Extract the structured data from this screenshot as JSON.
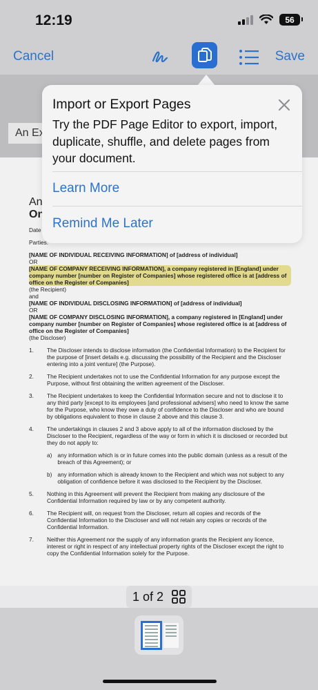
{
  "status_bar": {
    "time": "12:19",
    "battery": "56"
  },
  "toolbar": {
    "cancel_label": "Cancel",
    "save_label": "Save"
  },
  "document_title": "An Ex",
  "popover": {
    "title": "Import or Export Pages",
    "description": "Try the PDF Page Editor to export, import, duplicate, shuffle, and delete pages from your document.",
    "learn_more": "Learn More",
    "remind_later": "Remind Me Later"
  },
  "document": {
    "heading_line1": "An",
    "heading_line2": "On",
    "date_label": "Date",
    "parties_label": "Parties:",
    "parties": [
      "[NAME OF INDIVIDUAL RECEIVING INFORMATION] of [address of individual]",
      "OR",
      "[NAME OF COMPANY RECEIVING INFORMATION], a company registered in [England] under company number [number on Register of Companies] whose registered office is at [address of office on the Register of Companies]",
      "(the Recipient)",
      "and",
      "[NAME OF INDIVIDUAL DISCLOSING INFORMATION] of [address of individual]",
      "OR",
      "[NAME OF COMPANY DISCLOSING INFORMATION], a company registered in [England] under company number [number on Register of Companies] whose registered office is at [address of office on the Register of Companies]",
      "(the Discloser)"
    ],
    "clauses": [
      {
        "n": "1.",
        "text": "The Discloser intends to disclose information (the Confidential Information) to the Recipient for the purpose of [insert details e.g. discussing the possibility of the Recipient and the Discloser entering into a joint venture] (the Purpose)."
      },
      {
        "n": "2.",
        "text": "The Recipient undertakes not to use the Confidential Information for any purpose except the Purpose, without first obtaining the written agreement of the Discloser."
      },
      {
        "n": "3.",
        "text": "The Recipient undertakes to keep the Confidential Information secure and not to disclose it to any third party [except to its employees [and professional advisers] who need to know the same for the Purpose, who know they owe a duty of confidence to the Discloser and who are bound by obligations equivalent to those in clause 2 above and this clause 3."
      },
      {
        "n": "4.",
        "text": "The undertakings in clauses 2 and 3 above apply to all of the information disclosed by the Discloser to the Recipient, regardless of the way or form in which it is disclosed or recorded but they do not apply to:"
      }
    ],
    "subclauses": [
      {
        "n": "a)",
        "text": "any information which is or in future comes into the public domain (unless as a result of the breach of this Agreement); or"
      },
      {
        "n": "b)",
        "text": "any information which is already known to the Recipient and which was not subject to any obligation of confidence before it was disclosed to the Recipient by the Discloser."
      }
    ],
    "clauses_2": [
      {
        "n": "5.",
        "text": "Nothing in this Agreement will prevent the Recipient from making any disclosure of the Confidential Information required by law or by any competent authority."
      },
      {
        "n": "6.",
        "text": "The Recipient will, on request from the Discloser, return all copies and records of the Confidential Information to the Discloser and will not retain any copies or records of the Confidential Information."
      },
      {
        "n": "7.",
        "text": "Neither this Agreement nor the supply of any information grants the Recipient any licence, interest or right in respect of any intellectual property rights of the Discloser except the right to copy the Confidential Information solely for the Purpose."
      }
    ]
  },
  "page_indicator": {
    "label": "1 of 2"
  },
  "colors": {
    "accent": "#2d72c9",
    "highlight": "#d5c83c"
  }
}
